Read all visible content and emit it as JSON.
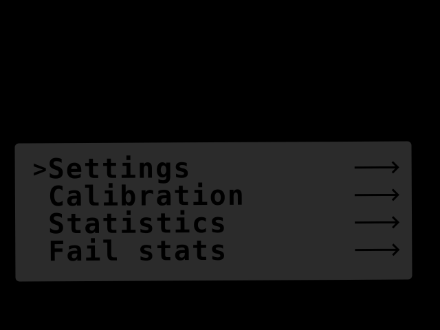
{
  "menu": {
    "cursor_glyph": ">",
    "selected_index": 0,
    "items": [
      {
        "label": "Settings",
        "arrow": "🡒",
        "arrow_icon": "arrow-right-icon"
      },
      {
        "label": "Calibration",
        "arrow": "🡒",
        "arrow_icon": "arrow-right-icon"
      },
      {
        "label": "Statistics",
        "arrow": "🡒",
        "arrow_icon": "arrow-right-icon"
      },
      {
        "label": "Fail stats",
        "arrow": "🡒",
        "arrow_icon": "arrow-right-icon"
      }
    ]
  },
  "colors": {
    "background": "#000000",
    "lcd_panel": "#2b2b2b",
    "pixel_text": "#000000"
  }
}
